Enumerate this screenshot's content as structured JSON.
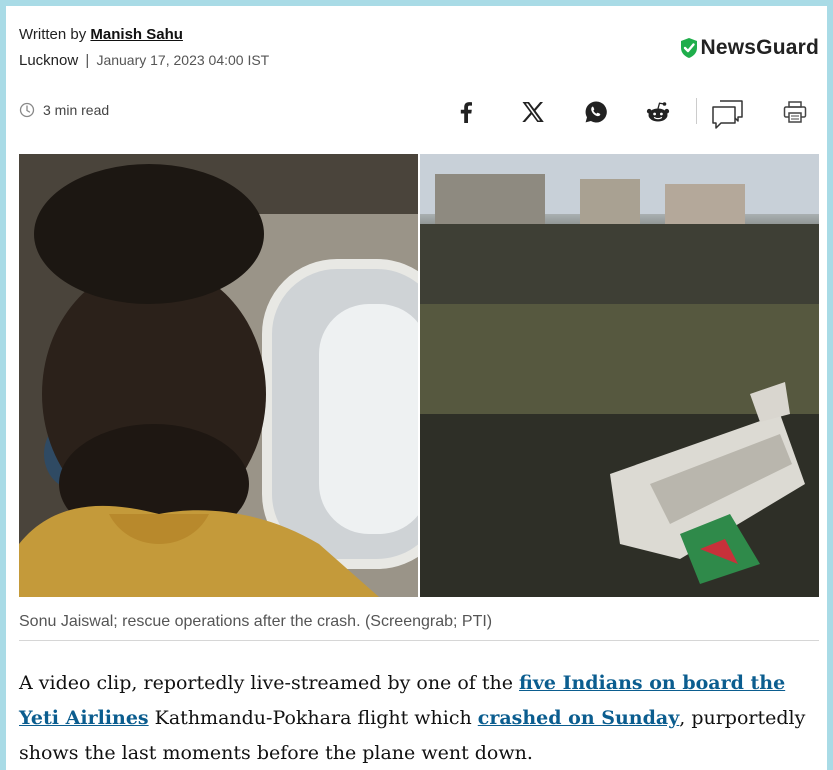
{
  "byline": {
    "prefix": "Written by",
    "author": "Manish Sahu"
  },
  "location": {
    "city": "Lucknow",
    "separator": "|",
    "date": "January 17, 2023 04:00 IST"
  },
  "brand": {
    "newsguard_label": "NewsGuard",
    "shield_color": "#1fae4b"
  },
  "read_time": "3 min read",
  "share_icons": [
    "facebook-icon",
    "x-icon",
    "whatsapp-icon",
    "reddit-icon",
    "comment-icon",
    "print-icon"
  ],
  "image": {
    "caption": "Sonu Jaiswal; rescue operations after the crash. (Screengrab; PTI)"
  },
  "article": {
    "p1_part1": "A video clip, reportedly live-streamed by one of the ",
    "link1": "five Indians on board the Yeti Airlines",
    "p1_part2": " Kathmandu-Pokhara flight which ",
    "link2": "crashed on Sunday",
    "p1_part3": ", purportedly shows the last moments before the plane went down."
  },
  "colors": {
    "link": "#0b5d8f",
    "page_border": "#a9dbe6"
  }
}
